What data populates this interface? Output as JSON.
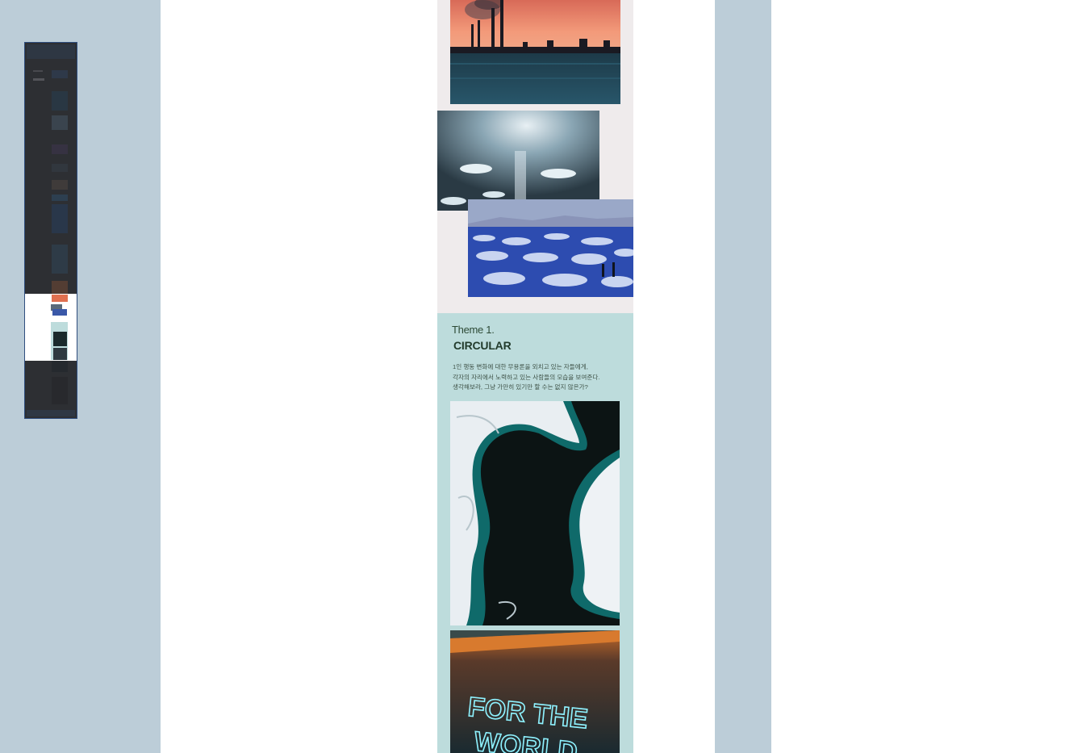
{
  "minimap": {
    "label": "page-overview",
    "colors": {
      "border": "#2f4e7e",
      "window": "#ffffff"
    }
  },
  "theme": {
    "kicker": "Theme 1.",
    "title": "CIRCULAR",
    "description": [
      "1인 행동 변화에 대한 무용론을 외치고 있는 자들에게,",
      "각자의 자리에서 노력하고 있는 사람들의 모습을 보여준다.",
      "생각해보라, 그냥 가만히 있기만 할 수는 없지 않은가?"
    ]
  },
  "neon_sign": {
    "line1": "FOR THE",
    "line2": "WORLD"
  },
  "colors": {
    "background": "#bccdd8",
    "page": "#ffffff",
    "collage_bg": "#efebec",
    "theme_bg": "#bddcdc",
    "title": "#223b2c"
  }
}
